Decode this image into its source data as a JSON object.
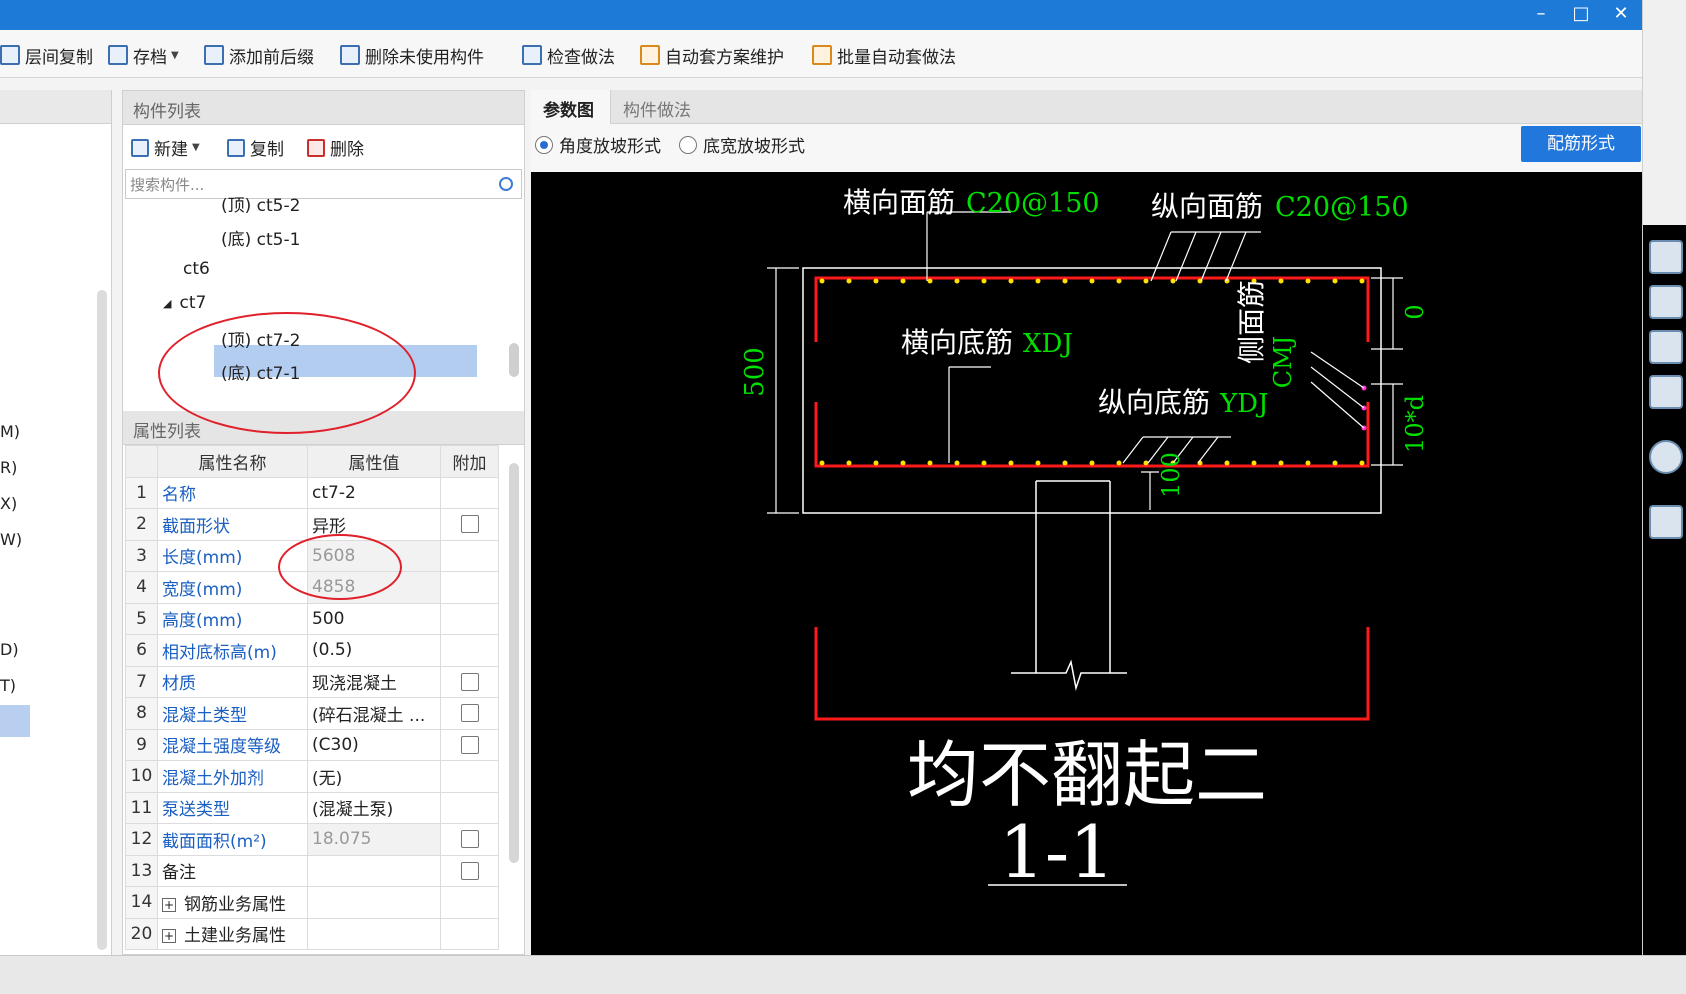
{
  "window": {
    "minimize_icon": "minimize-icon",
    "maximize_icon": "maximize-icon",
    "close_icon": "close-icon",
    "accent_color": "#1e7ad7"
  },
  "toolbar": {
    "items": [
      {
        "label": "层间复制",
        "icon": "floor-copy-icon"
      },
      {
        "label": "存档",
        "icon": "archive-icon"
      },
      {
        "label": "添加前后缀",
        "icon": "add-prefix-suffix-icon"
      },
      {
        "label": "删除未使用构件",
        "icon": "delete-unused-icon"
      },
      {
        "label": "检查做法",
        "icon": "check-method-icon"
      },
      {
        "label": "自动套方案维护",
        "icon": "auto-scheme-icon"
      },
      {
        "label": "批量自动套做法",
        "icon": "batch-auto-icon"
      }
    ]
  },
  "left_panel": {
    "items": [
      "M)",
      "R)",
      "X)",
      "W)",
      "D)",
      "T)"
    ]
  },
  "component_list": {
    "title": "构件列表",
    "new_label": "新建",
    "copy_label": "复制",
    "delete_label": "删除",
    "search_placeholder": "搜索构件...",
    "tree": [
      {
        "label": "(顶)  ct5-2"
      },
      {
        "label": "(底)  ct5-1"
      },
      {
        "label": "ct6"
      },
      {
        "label": "ct7",
        "expanded": true
      },
      {
        "label": "(顶)  ct7-2",
        "selected": true
      },
      {
        "label": "(底)  ct7-1"
      }
    ]
  },
  "property_list": {
    "title": "属性列表",
    "headers": {
      "name": "属性名称",
      "value": "属性值",
      "extra": "附加"
    },
    "rows": [
      {
        "num": "1",
        "name": "名称",
        "value": "ct7-2",
        "checkbox": false
      },
      {
        "num": "2",
        "name": "截面形状",
        "value": "异形",
        "checkbox": true
      },
      {
        "num": "3",
        "name": "长度(mm)",
        "value": "5608",
        "checkbox": false,
        "readonly": true
      },
      {
        "num": "4",
        "name": "宽度(mm)",
        "value": "4858",
        "checkbox": false,
        "readonly": true
      },
      {
        "num": "5",
        "name": "高度(mm)",
        "value": "500",
        "checkbox": false
      },
      {
        "num": "6",
        "name": "相对底标高(m)",
        "value": "(0.5)",
        "checkbox": false
      },
      {
        "num": "7",
        "name": "材质",
        "value": "现浇混凝土",
        "checkbox": true
      },
      {
        "num": "8",
        "name": "混凝土类型",
        "value": "(碎石混凝土 ...",
        "checkbox": true
      },
      {
        "num": "9",
        "name": "混凝土强度等级",
        "value": "(C30)",
        "checkbox": true
      },
      {
        "num": "10",
        "name": "混凝土外加剂",
        "value": "(无)",
        "checkbox": false
      },
      {
        "num": "11",
        "name": "泵送类型",
        "value": "(混凝土泵)",
        "checkbox": false
      },
      {
        "num": "12",
        "name": "截面面积(m²)",
        "value": "18.075",
        "checkbox": true,
        "readonly": true
      },
      {
        "num": "13",
        "name": "备注",
        "value": "",
        "checkbox": true,
        "black": true
      },
      {
        "num": "14",
        "name": "钢筋业务属性",
        "value": "",
        "checkbox": false,
        "group": true
      },
      {
        "num": "20",
        "name": "土建业务属性",
        "value": "",
        "checkbox": false,
        "group": true
      }
    ]
  },
  "param_panel": {
    "tabs": [
      "参数图",
      "构件做法"
    ],
    "radio_angle": "角度放坡形式",
    "radio_width": "底宽放坡形式",
    "rebar_button": "配筋形式"
  },
  "drawing": {
    "top_transverse_label": "横向面筋",
    "top_transverse_value": "C20@150",
    "top_longitudinal_label": "纵向面筋",
    "top_longitudinal_value": "C20@150",
    "bottom_transverse_label": "横向底筋",
    "bottom_transverse_value": "XDJ",
    "bottom_longitudinal_label": "纵向底筋",
    "bottom_longitudinal_value": "YDJ",
    "side_label": "侧面筋",
    "side_value": "CMJ",
    "height_dim": "500",
    "top_dim": "0",
    "side_dim": "10*d",
    "bottom_dim": "100",
    "note": "均不翻起二",
    "section": "1-1"
  }
}
